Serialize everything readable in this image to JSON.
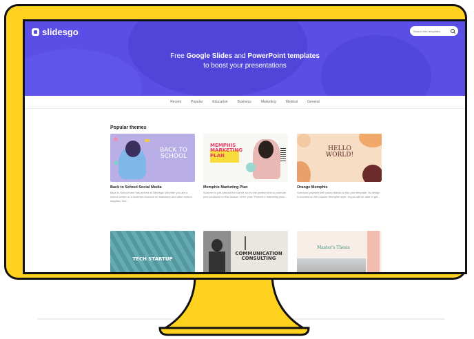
{
  "colors": {
    "monitor": "#ffd21f",
    "hero": "#5a4ee6"
  },
  "header": {
    "logo_text": "slidesgo",
    "search_placeholder": "Search free templates"
  },
  "hero": {
    "line1_pre": "Free ",
    "line1_gs": "Google Slides",
    "line1_mid": " and ",
    "line1_pp": "PowerPoint templates",
    "line2": "to boost your presentations"
  },
  "nav": [
    "Recent",
    "Popular",
    "Education",
    "Business",
    "Marketing",
    "Medical",
    "General"
  ],
  "section_title": "Popular themes",
  "cards": [
    {
      "title": "Back to School Social Media",
      "desc": "Back to School time has arrived at Slidesgo! Whether you are a school center or a business focused on stationary and other school supplies, this...",
      "thumb_text": "BACK TO SCHOOL"
    },
    {
      "title": "Memphis Marketing Plan",
      "desc": "Summer is just around the corner, so it's the perfect time to promote your products for this season of the year. Present a marketing plan...",
      "thumb_text": "MEMPHIS MARKETING PLAN"
    },
    {
      "title": "Orange Memphis",
      "desc": "Surround yourself with colors thanks to this new template. Its design is focused on the popular Memphis style, so you will be able to get...",
      "thumb_text": "HELLO WORLD!"
    },
    {
      "title": "",
      "desc": "",
      "thumb_text": "TECH STARTUP"
    },
    {
      "title": "",
      "desc": "",
      "thumb_text": "COMMUNICATION CONSULTING"
    },
    {
      "title": "",
      "desc": "",
      "thumb_text": "Master's Thesis"
    }
  ]
}
